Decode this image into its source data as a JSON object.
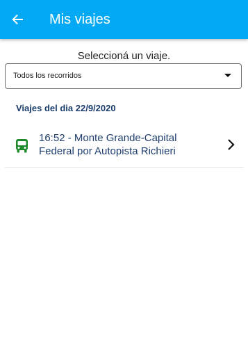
{
  "appbar": {
    "title": "Mis viajes",
    "back_icon": "arrow-left-icon",
    "color": "#03a9f4"
  },
  "main": {
    "subtitle": "Seleccioná un viaje.",
    "filter": {
      "selected": "Todos los recorridos",
      "caret_icon": "caret-down-icon"
    },
    "section_header": "Viajes del dia 22/9/2020",
    "trips": [
      {
        "icon": "bus-icon",
        "icon_color": "#1e8a2e",
        "label": "16:52 - Monte Grande-Capital Federal por Autopista Richieri",
        "chevron_icon": "chevron-right-icon"
      }
    ]
  }
}
